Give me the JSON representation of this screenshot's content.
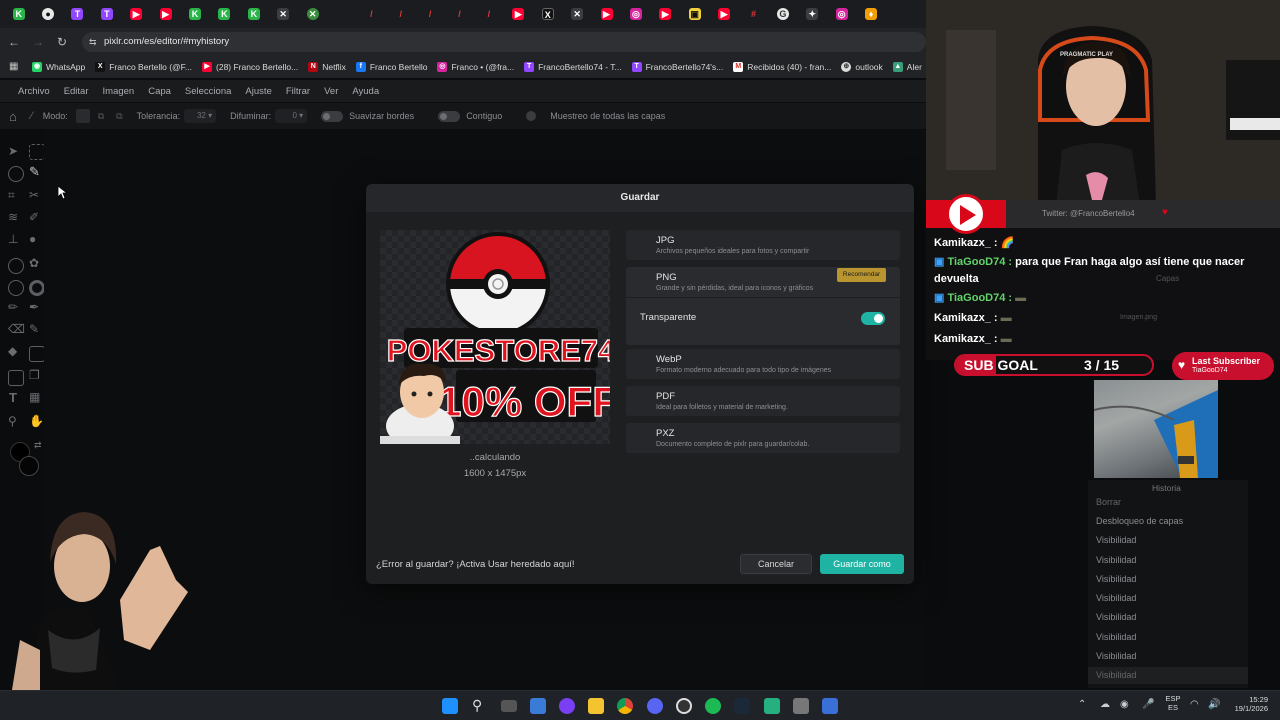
{
  "browser": {
    "url": "pixlr.com/es/editor/#myhistory",
    "bookmarks": [
      "WhatsApp",
      "Franco Bertello (@F...",
      "(28) Franco Bertello...",
      "Netflix",
      "Franco Bertello",
      "Franco • (@fra...",
      "FrancoBertello74 - T...",
      "FrancoBertello74's...",
      "Recibidos (40) - fran...",
      "outlook",
      "Aler"
    ]
  },
  "app": {
    "menu": [
      "Archivo",
      "Editar",
      "Imagen",
      "Capa",
      "Selecciona",
      "Ajuste",
      "Filtrar",
      "Ver",
      "Ayuda"
    ],
    "options": {
      "mode_label": "Modo:",
      "tolerance_label": "Tolerancia:",
      "tolerance_value": "32",
      "blur_label": "Difuminar:",
      "blur_value": "0",
      "smooth_label": "Suavizar bordes",
      "contiguous_label": "Contiguo",
      "sample_label": "Muestreo de todas las capas"
    }
  },
  "dialog": {
    "title": "Guardar",
    "preview_text_main": "POKESTORE74",
    "preview_text_promo": "10% OFF",
    "calculating": "..calculando",
    "dimensions": "1600 x 1475px",
    "formats": [
      {
        "name": "JPG",
        "desc": "Archivos pequeños ideales para fotos y compartir"
      },
      {
        "name": "PNG",
        "desc": "Grande y sin pérdidas, ideal para iconos y gráficos"
      },
      {
        "name": "WebP",
        "desc": "Formato moderno adecuado para todo tipo de imágenes"
      },
      {
        "name": "PDF",
        "desc": "Ideal para folletos y material de marketing."
      },
      {
        "name": "PXZ",
        "desc": "Documento completo de pixlr para guardar/colab."
      }
    ],
    "recommended_badge": "Recomendar",
    "transparent_label": "Transparente",
    "error_text": "¿Error al guardar? ¡Activa Usar heredado aquí!",
    "cancel": "Cancelar",
    "save_as": "Guardar como"
  },
  "stream": {
    "chair_brand": "PRAGMATIC PLAY",
    "twitter": "Twitter: @FrancoBertello4",
    "chat": [
      {
        "user": "Kamikazx_ :",
        "text": ""
      },
      {
        "user": "TiaGooD74 :",
        "text": "para que Fran haga algo así tiene que nacer devuelta"
      },
      {
        "user": "TiaGooD74 :",
        "text": ""
      },
      {
        "user": "Kamikazx_ :",
        "text": ""
      },
      {
        "user": "Kamikazx_ :",
        "text": ""
      }
    ],
    "sub_goal_label": "SUB GOAL",
    "sub_goal_value": "3 / 15",
    "last_subscriber_label": "Last Subscriber",
    "last_subscriber_name": "TiaGooD74",
    "panel_layers": "Capas",
    "layer_name": "Imagen.png",
    "history_title": "Historia",
    "history_items": [
      "Borrar",
      "Desbloqueo de capas",
      "Visibilidad",
      "Visibilidad",
      "Visibilidad",
      "Visibilidad",
      "Visibilidad",
      "Visibilidad",
      "Visibilidad",
      "Visibilidad"
    ]
  },
  "taskbar": {
    "lang_top": "ESP",
    "lang_bottom": "ES",
    "time": "15:29",
    "date": "19/1/2026"
  },
  "colors": {
    "accent": "#1fb3a3",
    "badge": "#b8952f",
    "pokeball_red": "#d7141f",
    "stream_red": "#c8102e"
  }
}
